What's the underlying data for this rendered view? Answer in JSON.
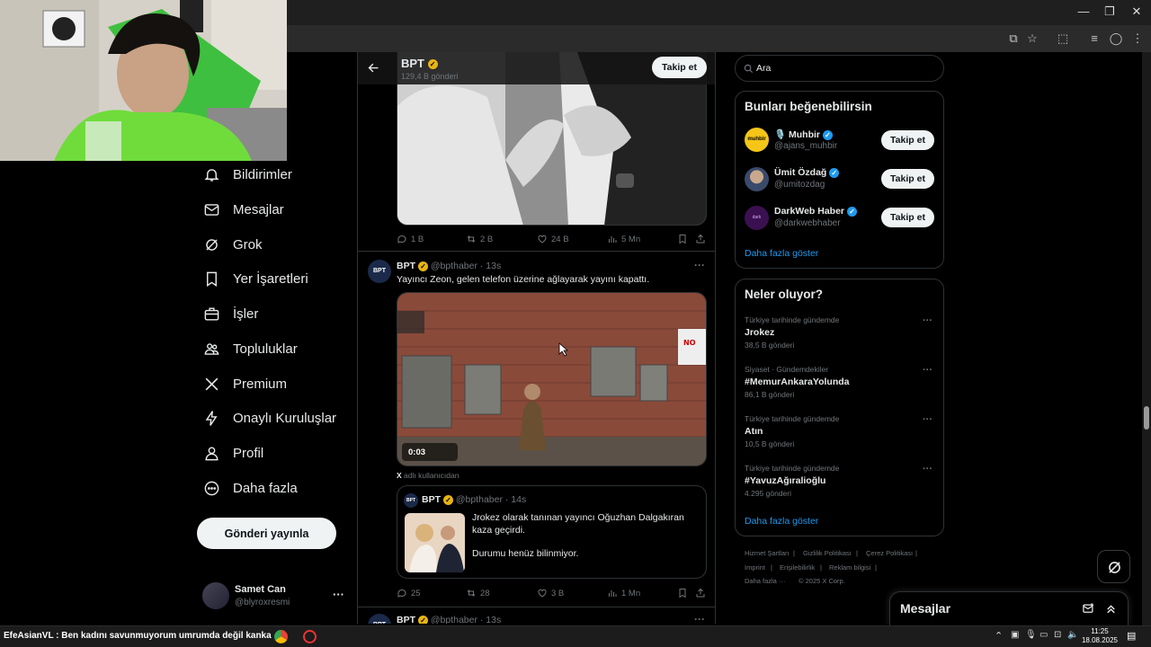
{
  "stream_overlay": {
    "ticker": "EfeAsianVL : Ben kadını savunmuyorum umrumda değil kanka"
  },
  "sidebar": {
    "items": [
      {
        "label": "Bildirimler",
        "icon": "bell-icon"
      },
      {
        "label": "Mesajlar",
        "icon": "mail-icon"
      },
      {
        "label": "Grok",
        "icon": "grok-icon"
      },
      {
        "label": "Yer İşaretleri",
        "icon": "bookmark-icon"
      },
      {
        "label": "İşler",
        "icon": "briefcase-icon"
      },
      {
        "label": "Topluluklar",
        "icon": "communities-icon"
      },
      {
        "label": "Premium",
        "icon": "x-logo-icon"
      },
      {
        "label": "Onaylı Kuruluşlar",
        "icon": "lightning-icon"
      },
      {
        "label": "Profil",
        "icon": "person-icon"
      },
      {
        "label": "Daha fazla",
        "icon": "more-circle-icon"
      }
    ],
    "post_button": "Gönderi yayınla",
    "account": {
      "name": "Samet Can",
      "handle": "@blyroxresmi"
    }
  },
  "main": {
    "header": {
      "title": "BPT",
      "subtitle": "129,4 B gönderi",
      "follow": "Takip et"
    },
    "tweet1_actions": {
      "replies": "1 B",
      "reposts": "2 B",
      "likes": "24 B",
      "views": "5 Mn"
    },
    "tweet2": {
      "name": "BPT",
      "handle": "@bpthaber",
      "time": "· 13s",
      "text": "Yayıncı Zeon, gelen telefon üzerine ağlayarak yayını kapattı.",
      "video_time": "0:03",
      "from_user_prefix": "X",
      "from_user_suffix": "adlı kullanıcıdan",
      "quote": {
        "name": "BPT",
        "handle": "@bpthaber",
        "time": "· 14s",
        "text1": "Jrokez olarak tanınan yayıncı Oğuzhan Dalgakıran kaza geçirdi.",
        "text2": "Durumu henüz bilinmiyor."
      },
      "actions": {
        "replies": "25",
        "reposts": "28",
        "likes": "3 B",
        "views": "1 Mn"
      }
    },
    "tweet3": {
      "name": "BPT",
      "handle": "@bpthaber",
      "time": "· 13s"
    }
  },
  "right": {
    "search_placeholder": "Ara",
    "who_to_follow": {
      "title": "Bunları beğenebilirsin",
      "users": [
        {
          "name": "🎙️ Muhbir",
          "handle": "@ajans_muhbir",
          "follow": "Takip et",
          "avatar_color": "#f5c518"
        },
        {
          "name": "Ümit Özdağ",
          "handle": "@umitozdag",
          "follow": "Takip et",
          "avatar_color": "#3a4a6a"
        },
        {
          "name": "DarkWeb Haber",
          "handle": "@darkwebhaber",
          "follow": "Takip et",
          "avatar_color": "#4a1a5a"
        }
      ],
      "show_more": "Daha fazla göster"
    },
    "trends": {
      "title": "Neler oluyor?",
      "items": [
        {
          "meta": "Türkiye tarihinde gündemde",
          "name": "Jrokez",
          "count": "38,5 B gönderi"
        },
        {
          "meta": "Siyaset · Gündemdekiler",
          "name": "#MemurAnkaraYolunda",
          "count": "86,1 B gönderi"
        },
        {
          "meta": "Türkiye tarihinde gündemde",
          "name": "Atın",
          "count": "10,5 B gönderi"
        },
        {
          "meta": "Türkiye tarihinde gündemde",
          "name": "#YavuzAğıralioğlu",
          "count": "4.295 gönderi"
        }
      ],
      "show_more": "Daha fazla göster"
    },
    "footer": {
      "links": [
        "Hizmet Şartları",
        "Gizlilik Politikası",
        "Çerez Politikası",
        "Imprint",
        "Erişilebilirlik",
        "Reklam bilgisi",
        "Daha fazla ···",
        "© 2025 X Corp."
      ]
    }
  },
  "messages_drawer": {
    "title": "Mesajlar"
  },
  "taskbar": {
    "time": "11:25",
    "date": "18.08.2025"
  },
  "colors": {
    "accent": "#1d9bf0",
    "verified_gold": "#e8b512",
    "bg": "#000000",
    "border": "#2f3336"
  }
}
